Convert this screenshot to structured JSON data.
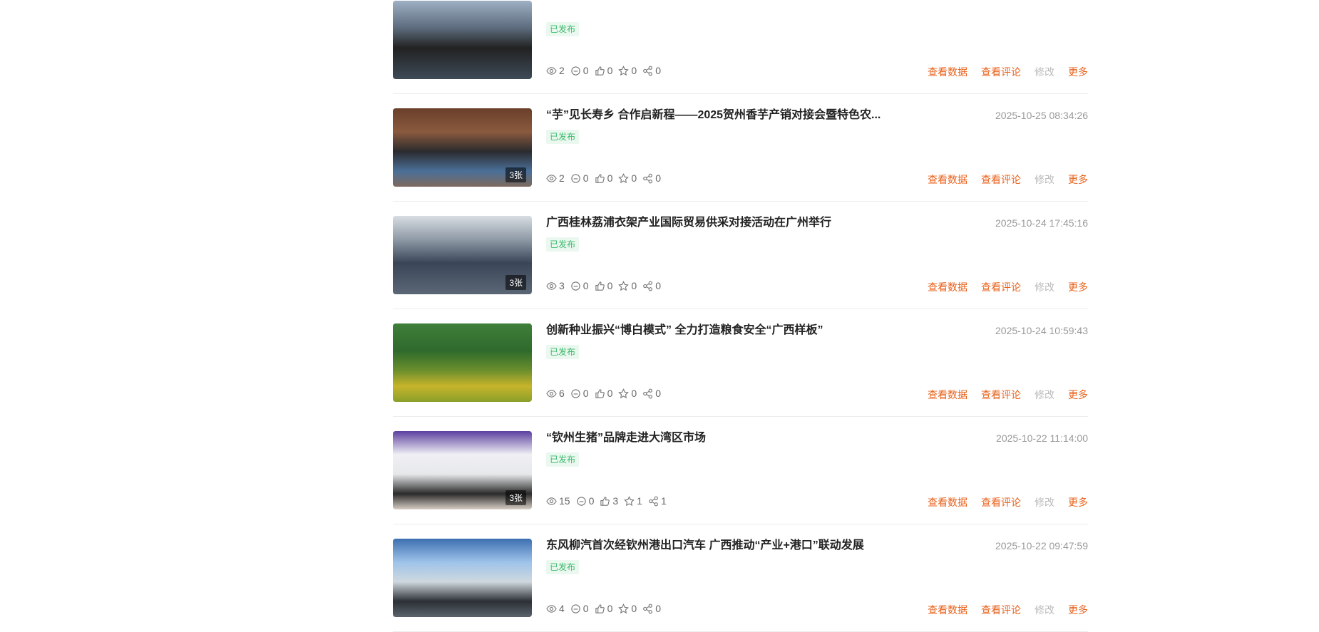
{
  "icons": [
    "eye-icon",
    "comment-icon",
    "thumbs-up-icon",
    "star-icon",
    "share-icon"
  ],
  "colors": {
    "action": "#e8621c",
    "disabled": "#bbbbbb",
    "published": "#3dba6c"
  },
  "action_labels": {
    "data": "查看数据",
    "comments": "查看评论",
    "edit": "修改",
    "more": "更多"
  },
  "articles": [
    {
      "title": "",
      "time": "",
      "status": "已发布",
      "image_count": "",
      "stats": {
        "views": "2",
        "comments": "0",
        "likes": "0",
        "favorites": "0",
        "shares": "0"
      }
    },
    {
      "title": "“芋”见长寿乡 合作启新程——2025贺州香芋产销对接会暨特色农...",
      "time": "2025-10-25 08:34:26",
      "status": "已发布",
      "image_count": "3张",
      "stats": {
        "views": "2",
        "comments": "0",
        "likes": "0",
        "favorites": "0",
        "shares": "0"
      }
    },
    {
      "title": "广西桂林荔浦衣架产业国际贸易供采对接活动在广州举行",
      "time": "2025-10-24 17:45:16",
      "status": "已发布",
      "image_count": "3张",
      "stats": {
        "views": "3",
        "comments": "0",
        "likes": "0",
        "favorites": "0",
        "shares": "0"
      }
    },
    {
      "title": "创新种业振兴“博白模式” 全力打造粮食安全“广西样板”",
      "time": "2025-10-24 10:59:43",
      "status": "已发布",
      "image_count": "",
      "stats": {
        "views": "6",
        "comments": "0",
        "likes": "0",
        "favorites": "0",
        "shares": "0"
      }
    },
    {
      "title": "“钦州生猪”品牌走进大湾区市场",
      "time": "2025-10-22 11:14:00",
      "status": "已发布",
      "image_count": "3张",
      "stats": {
        "views": "15",
        "comments": "0",
        "likes": "3",
        "favorites": "1",
        "shares": "1"
      }
    },
    {
      "title": "东风柳汽首次经钦州港出口汽车 广西推动“产业+港口”联动发展",
      "time": "2025-10-22 09:47:59",
      "status": "已发布",
      "image_count": "",
      "stats": {
        "views": "4",
        "comments": "0",
        "likes": "0",
        "favorites": "0",
        "shares": "0"
      }
    }
  ]
}
